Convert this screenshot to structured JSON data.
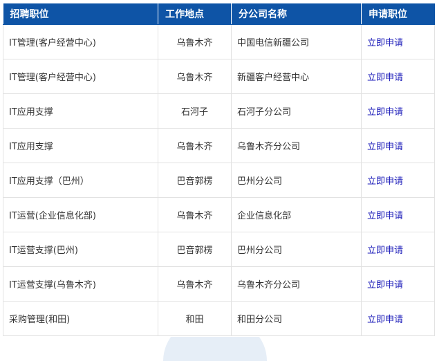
{
  "table": {
    "headers": [
      "招聘职位",
      "工作地点",
      "分公司名称",
      "申请职位"
    ],
    "rows": [
      {
        "position": "IT管理(客户经营中心)",
        "location": "乌鲁木齐",
        "branch": "中国电信新疆公司",
        "apply": "立即申请"
      },
      {
        "position": "IT管理(客户经营中心)",
        "location": "乌鲁木齐",
        "branch": "新疆客户经营中心",
        "apply": "立即申请"
      },
      {
        "position": "IT应用支撑",
        "location": "石河子",
        "branch": "石河子分公司",
        "apply": "立即申请"
      },
      {
        "position": "IT应用支撑",
        "location": "乌鲁木齐",
        "branch": "乌鲁木齐分公司",
        "apply": "立即申请"
      },
      {
        "position": "IT应用支撑（巴州）",
        "location": "巴音郭楞",
        "branch": "巴州分公司",
        "apply": "立即申请"
      },
      {
        "position": "IT运营(企业信息化部)",
        "location": "乌鲁木齐",
        "branch": "企业信息化部",
        "apply": "立即申请"
      },
      {
        "position": "IT运营支撑(巴州)",
        "location": "巴音郭楞",
        "branch": "巴州分公司",
        "apply": "立即申请"
      },
      {
        "position": "IT运营支撑(乌鲁木齐)",
        "location": "乌鲁木齐",
        "branch": "乌鲁木齐分公司",
        "apply": "立即申请"
      },
      {
        "position": "采购管理(和田)",
        "location": "和田",
        "branch": "和田分公司",
        "apply": "立即申请"
      }
    ]
  },
  "colors": {
    "header_bg": "#0e54a6",
    "header_text": "#ffffff",
    "link": "#1a1ab8",
    "border": "#e2e2e2"
  }
}
